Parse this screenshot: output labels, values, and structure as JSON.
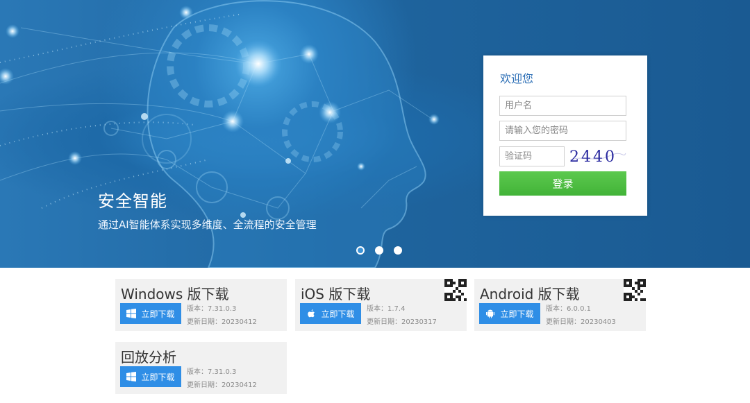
{
  "banner": {
    "title": "安全智能",
    "subtitle": "通过AI智能体系实现多维度、全流程的安全管理",
    "slides": 3,
    "active_slide": 1
  },
  "login": {
    "title": "欢迎您",
    "username_placeholder": "用户名",
    "password_placeholder": "请输入您的密码",
    "captcha_placeholder": "验证码",
    "captcha_text": "2440",
    "submit_label": "登录",
    "accent_color": "#2a6db5",
    "button_color": "#4cbd42"
  },
  "downloads": [
    {
      "title": "Windows 版下载",
      "button": "立即下载",
      "icon": "windows-icon",
      "version": "版本：7.31.0.3",
      "date": "更新日期：20230412",
      "qr": false
    },
    {
      "title": "iOS 版下载",
      "button": "立即下载",
      "icon": "apple-icon",
      "version": "版本：1.7.4",
      "date": "更新日期：20230317",
      "qr": true
    },
    {
      "title": "Android 版下载",
      "button": "立即下载",
      "icon": "android-icon",
      "version": "版本：6.0.0.1",
      "date": "更新日期：20230403",
      "qr": true
    },
    {
      "title": "回放分析",
      "button": "立即下载",
      "icon": "windows-icon",
      "version": "版本：7.31.0.3",
      "date": "更新日期：20230412",
      "qr": false
    }
  ],
  "colors": {
    "download_button": "#2f8ee6",
    "card_bg": "#f1f1f1"
  }
}
